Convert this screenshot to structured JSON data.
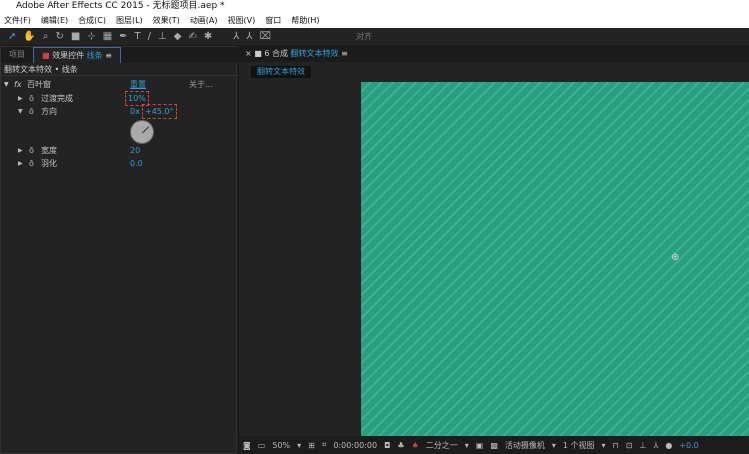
{
  "app": {
    "logo": "Ae",
    "title": "Adobe After Effects CC 2015 - 无标题项目.aep *"
  },
  "menu": [
    "文件(F)",
    "编辑(E)",
    "合成(C)",
    "图层(L)",
    "效果(T)",
    "动画(A)",
    "视图(V)",
    "窗口",
    "帮助(H)"
  ],
  "toolbar": {
    "tools": [
      "selection-icon",
      "hand-icon",
      "zoom-icon",
      "rotate-icon",
      "camera-icon",
      "pan-behind-icon",
      "rectangle-icon",
      "pen-icon",
      "text-icon",
      "brush-icon",
      "clone-stamp-icon",
      "eraser-icon",
      "roto-brush-icon",
      "puppet-pin-icon"
    ],
    "align_label": "对齐"
  },
  "left_panel": {
    "tabs": [
      {
        "label": "项目"
      },
      {
        "label": "效果控件",
        "sub": "线条"
      }
    ],
    "header": "翻转文本特效 • 线条",
    "effect": {
      "name": "百叶窗",
      "reset": "重置",
      "about": "关于...",
      "props": [
        {
          "label": "过渡完成",
          "value": "10%"
        },
        {
          "label": "方向",
          "value_prefix": "0x",
          "value": "+45.0°"
        },
        {
          "label": "宽度",
          "value": "20"
        },
        {
          "label": "羽化",
          "value": "0.0"
        }
      ]
    }
  },
  "right_panel": {
    "tab_label": "合成",
    "tab_comp": "翻转文本特效",
    "sub_tab": "翻转文本特效",
    "viewer": {
      "zoom": "50%",
      "timecode": "0:00:00:00",
      "resolution": "二分之一",
      "camera": "活动摄像机",
      "views": "1 个视图",
      "exposure": "+0.0"
    }
  },
  "colors": {
    "accent": "#2e9fd8",
    "comp_bg": "#2a9f80",
    "highlight": "#e04040"
  }
}
